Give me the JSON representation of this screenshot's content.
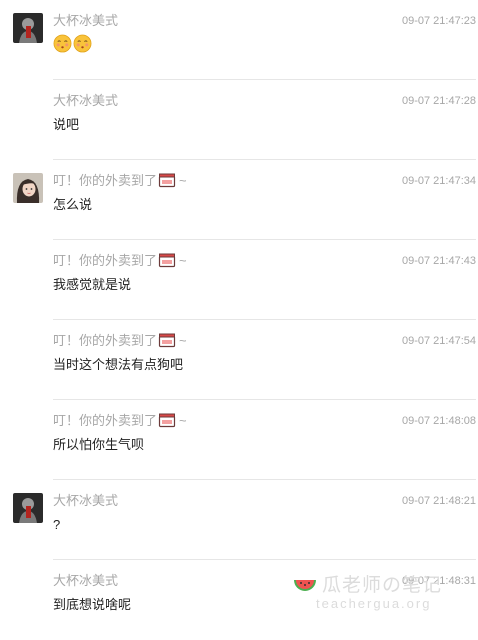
{
  "messages": [
    {
      "sender": "大杯冰美式",
      "time": "09-07 21:47:23",
      "content": "",
      "emoji_count": 2,
      "avatar": "dark-avatar",
      "sender_icon": ""
    },
    {
      "sender": "大杯冰美式",
      "time": "09-07 21:47:28",
      "content": "说吧",
      "avatar": "",
      "sender_icon": ""
    },
    {
      "sender": "叮！你的外卖到了",
      "sender_suffix": "~",
      "time": "09-07 21:47:34",
      "content": "怎么说",
      "avatar": "girl-avatar",
      "sender_icon": "takeout-box-icon"
    },
    {
      "sender": "叮！你的外卖到了",
      "sender_suffix": "~",
      "time": "09-07 21:47:43",
      "content": "我感觉就是说",
      "avatar": "",
      "sender_icon": "takeout-box-icon"
    },
    {
      "sender": "叮！你的外卖到了",
      "sender_suffix": "~",
      "time": "09-07 21:47:54",
      "content": "当时这个想法有点狗吧",
      "avatar": "",
      "sender_icon": "takeout-box-icon"
    },
    {
      "sender": "叮！你的外卖到了",
      "sender_suffix": "~",
      "time": "09-07 21:48:08",
      "content": "所以怕你生气呗",
      "avatar": "",
      "sender_icon": "takeout-box-icon"
    },
    {
      "sender": "大杯冰美式",
      "time": "09-07 21:48:21",
      "content": "?",
      "avatar": "dark-avatar",
      "sender_icon": ""
    },
    {
      "sender": "大杯冰美式",
      "time": "09-07 21:48:31",
      "content": "到底想说啥呢",
      "avatar": "",
      "sender_icon": ""
    }
  ],
  "watermark": {
    "title": "瓜老师の笔记",
    "url": "teachergua.org"
  },
  "colors": {
    "meta_text": "#a7a7a7",
    "content_text": "#222222",
    "divider": "#e6e6e6"
  }
}
